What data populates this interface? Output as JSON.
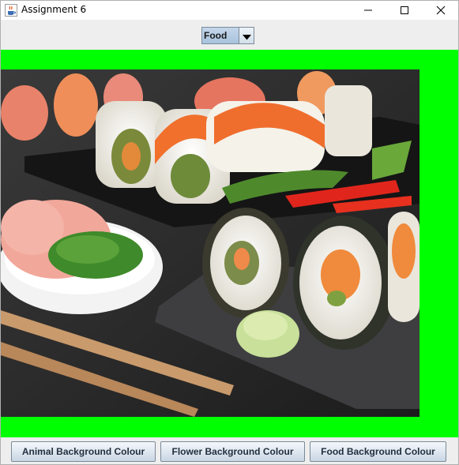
{
  "window": {
    "title": "Assignment 6",
    "app_icon": "java-cup-icon",
    "controls": {
      "minimize_icon": "minimize-icon",
      "maximize_icon": "maximize-icon",
      "close_icon": "close-icon"
    }
  },
  "combo": {
    "selected": "Food",
    "arrow_icon": "chevron-down-icon"
  },
  "panel": {
    "background_color": "#00ff00",
    "image_subject": "sushi platter"
  },
  "buttons": {
    "animal": "Animal Background Colour",
    "flower": "Flower Background Colour",
    "food": "Food Background Colour"
  }
}
